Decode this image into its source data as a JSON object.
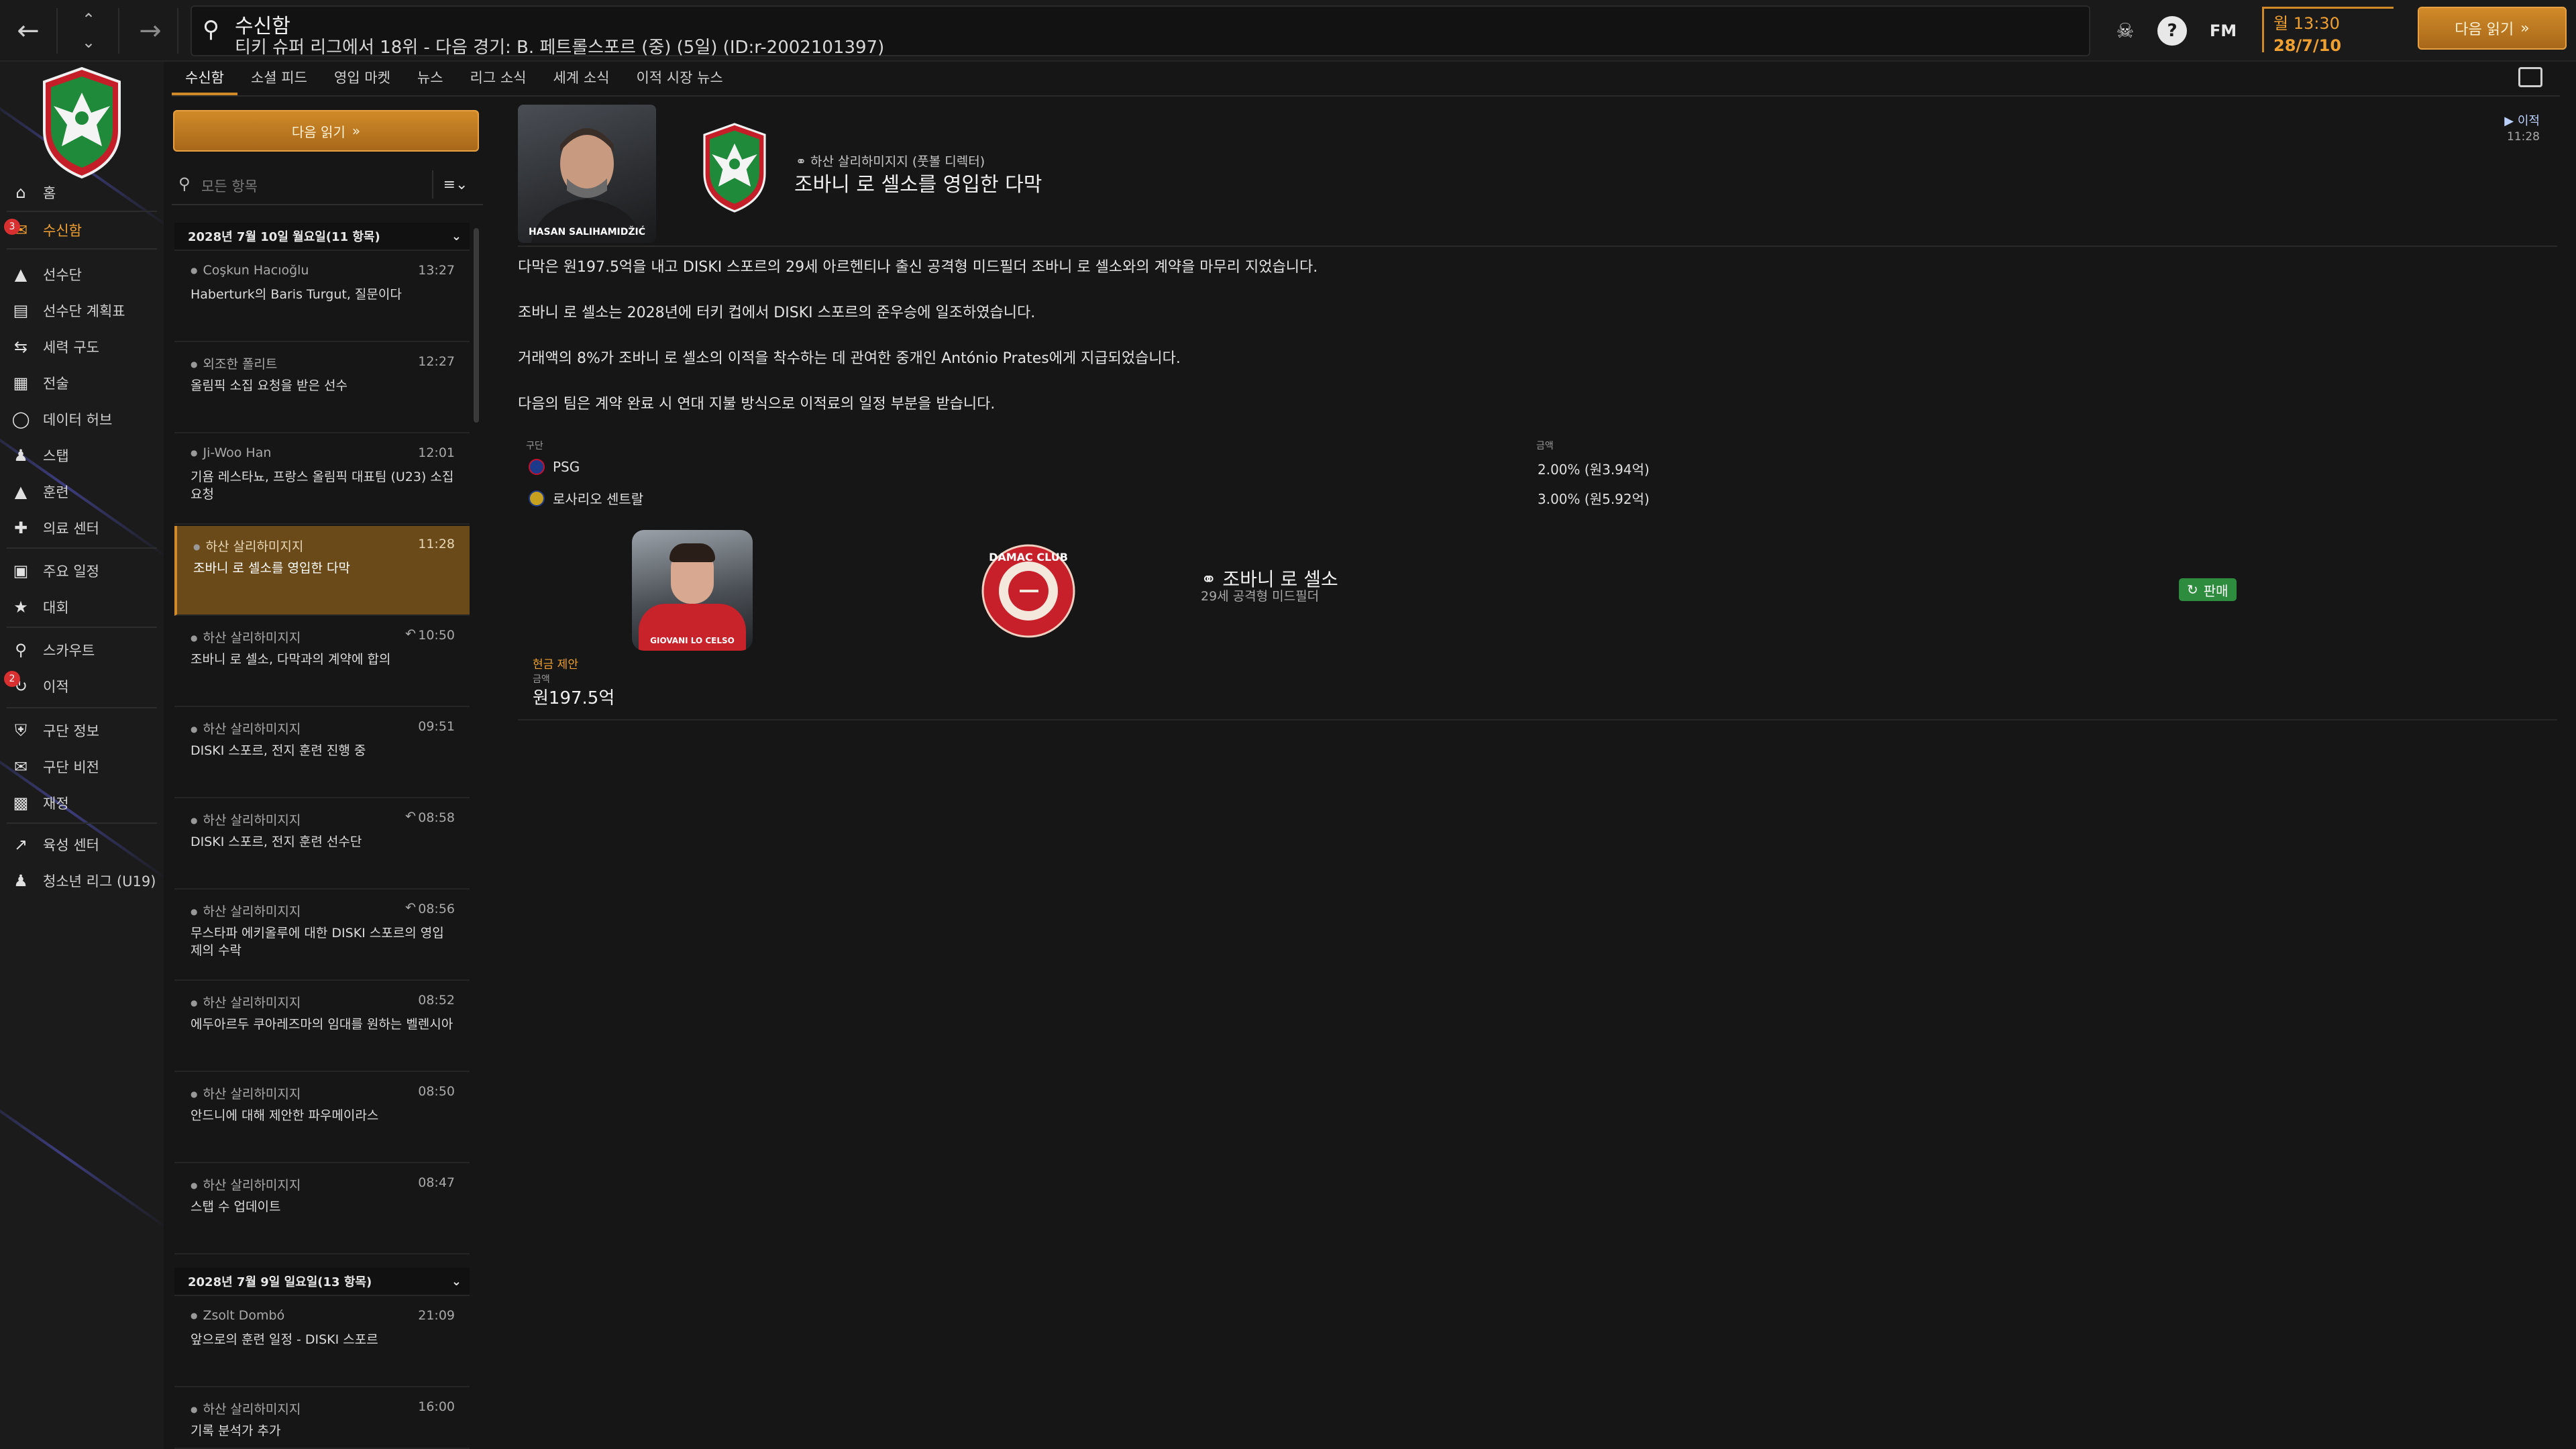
{
  "topbar": {
    "search_title": "수신함",
    "search_subtitle": "티키 슈퍼 리그에서 18위 - 다음 경기: B. 페트롤스포르 (중) (5일) (ID:r-2002101397)",
    "fm_label": "FM",
    "time": "월 13:30",
    "date": "28/7/10",
    "continue_label": "다음 읽기"
  },
  "sidebar": {
    "items": [
      {
        "label": "홈",
        "icon": "home-icon"
      },
      {
        "label": "수신함",
        "icon": "inbox-icon",
        "badge": "3"
      },
      {
        "label": "선수단",
        "icon": "shirt-icon"
      },
      {
        "label": "선수단 계획표",
        "icon": "clipboard-icon"
      },
      {
        "label": "세력 구도",
        "icon": "dynamics-icon"
      },
      {
        "label": "전술",
        "icon": "tactics-icon"
      },
      {
        "label": "데이터 허브",
        "icon": "data-icon"
      },
      {
        "label": "스탭",
        "icon": "staff-icon"
      },
      {
        "label": "훈련",
        "icon": "training-icon"
      },
      {
        "label": "의료 센터",
        "icon": "medical-icon"
      },
      {
        "label": "주요 일정",
        "icon": "calendar-icon"
      },
      {
        "label": "대회",
        "icon": "trophy-icon"
      },
      {
        "label": "스카우트",
        "icon": "scout-icon"
      },
      {
        "label": "이적",
        "icon": "transfer-icon",
        "badge": "2"
      },
      {
        "label": "구단 정보",
        "icon": "shield-icon"
      },
      {
        "label": "구단 비전",
        "icon": "vision-icon"
      },
      {
        "label": "재정",
        "icon": "finance-icon"
      },
      {
        "label": "육성 센터",
        "icon": "development-icon"
      },
      {
        "label": "청소년 리그 (U19)",
        "icon": "youth-icon"
      }
    ]
  },
  "tabs": [
    "수신함",
    "소셜 피드",
    "영입 마켓",
    "뉴스",
    "리그 소식",
    "세계 소식",
    "이적 시장 뉴스"
  ],
  "inbox": {
    "continue_label": "다음 읽기",
    "filter_placeholder": "모든 항목",
    "groups": [
      {
        "header": "2028년 7월 10일 월요일(11 항목)"
      },
      {
        "header": "2028년 7월 9일 일요일(13 항목)"
      }
    ],
    "messages": [
      {
        "from": "Coşkun Hacıoğlu",
        "time": "13:27",
        "subject": "Haberturk의 Baris Turgut, 질문이다"
      },
      {
        "from": "외조한 폴리트",
        "time": "12:27",
        "subject": "올림픽 소집 요청을 받은 선수"
      },
      {
        "from": "Ji-Woo Han",
        "time": "12:01",
        "subject": "기욤 레스타뇨, 프랑스 올림픽 대표팀 (U23) 소집 요청"
      },
      {
        "from": "하산 살리하미지지",
        "time": "11:28",
        "subject": "조바니 로 셀소를 영입한 다막"
      },
      {
        "from": "하산 살리하미지지",
        "time": "10:50",
        "subject": "조바니 로 셀소, 다막과의 계약에 합의"
      },
      {
        "from": "하산 살리하미지지",
        "time": "09:51",
        "subject": "DISKI 스포르, 전지 훈련 진행 중"
      },
      {
        "from": "하산 살리하미지지",
        "time": "08:58",
        "subject": "DISKI 스포르, 전지 훈련 선수단"
      },
      {
        "from": "하산 살리하미지지",
        "time": "08:56",
        "subject": "무스타파 에키올루에 대한 DISKI 스포르의 영입 제의 수락"
      },
      {
        "from": "하산 살리하미지지",
        "time": "08:52",
        "subject": "에두아르두 쿠아레즈마의 임대를 원하는 벨렌시아"
      },
      {
        "from": "하산 살리하미지지",
        "time": "08:50",
        "subject": "안드니에 대해 제안한 파우메이라스"
      },
      {
        "from": "하산 살리하미지지",
        "time": "08:47",
        "subject": "스탭 수 업데이트"
      },
      {
        "from": "Zsolt Dombó",
        "time": "21:09",
        "subject": "앞으로의 훈련 일정 - DISKI 스포르"
      },
      {
        "from": "하산 살리하미지지",
        "time": "16:00",
        "subject": "기록 분석가 추가"
      }
    ]
  },
  "detail": {
    "manager_caption": "HASAN SALIHAMIDŽIĆ",
    "sender": "하산 살리하미지지 (풋볼 디렉터)",
    "title": "조바니 로 셀소를 영입한 다막",
    "category": "이적",
    "time": "11:28",
    "paragraphs": [
      "다막은 원197.5억을 내고 DISKI 스포르의 29세 아르헨티나 출신 공격형 미드필더 조바니 로 셀소와의 계약을 마무리 지었습니다.",
      "조바니 로 셀소는 2028년에 터키 컵에서 DISKI 스포르의 준우승에 일조하였습니다.",
      "거래액의 8%가 조바니 로 셀소의 이적을 착수하는 데 관여한 중개인 António Prates에게 지급되었습니다.",
      "다음의 팀은 계약 완료 시 연대 지불 방식으로 이적료의 일정 부분을 받습니다."
    ],
    "table": {
      "col_club": "구단",
      "col_amount": "금액",
      "rows": [
        {
          "club": "PSG",
          "amount": "2.00% (원3.94억)",
          "color": "#1e3a8a"
        },
        {
          "club": "로사리오 센트랄",
          "amount": "3.00% (원5.92억)",
          "color": "#c8a020"
        }
      ]
    },
    "player": {
      "photo_caption": "GIOVANI LO CELSO",
      "name": "조바니 로 셀소",
      "subtitle": "29세 공격형 미드필더",
      "status": "판매",
      "club_logo_text": "DAMAC CLUB"
    },
    "payment": {
      "label": "현금 제안",
      "amount_label": "금액",
      "amount": "원197.5억"
    }
  }
}
